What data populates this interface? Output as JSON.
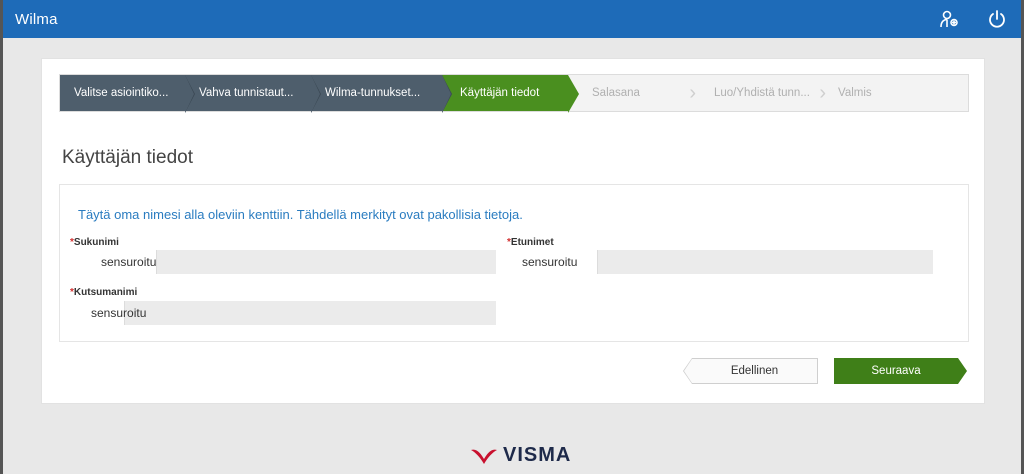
{
  "app": {
    "title": "Wilma"
  },
  "topbar": {
    "icons": [
      "user-switch-icon",
      "power-icon"
    ]
  },
  "wizard": {
    "steps": [
      {
        "label": "Valitse asiointiko...",
        "state": "done"
      },
      {
        "label": "Vahva tunnistaut...",
        "state": "done"
      },
      {
        "label": "Wilma-tunnukset...",
        "state": "done"
      },
      {
        "label": "Käyttäjän tiedot",
        "state": "current"
      },
      {
        "label": "Salasana",
        "state": "todo"
      },
      {
        "label": "Luo/Yhdistä tunn...",
        "state": "todo"
      },
      {
        "label": "Valmis",
        "state": "todo"
      }
    ]
  },
  "page": {
    "title": "Käyttäjän tiedot"
  },
  "form": {
    "instruction": "Täytä oma nimesi alla oleviin kenttiin. Tähdellä merkityt ovat pakollisia tietoja.",
    "required_mark": "*",
    "fields": {
      "sukunimi": {
        "label": "Sukunimi",
        "value": "sensuroitu"
      },
      "etunimet": {
        "label": "Etunimet",
        "value": "sensuroitu"
      },
      "kutsumanimi": {
        "label": "Kutsumanimi",
        "value": "sensuroitu"
      }
    }
  },
  "buttons": {
    "previous": "Edellinen",
    "next": "Seuraava"
  },
  "footer": {
    "logo_text": "VISMA"
  },
  "colors": {
    "topbar": "#1e6bb8",
    "step_done": "#4e5e6c",
    "step_current": "#4a8f1f",
    "next_button": "#3f7f18",
    "instruction_text": "#2a7cc0",
    "required": "#d23030",
    "logo_mark": "#c8102e"
  }
}
